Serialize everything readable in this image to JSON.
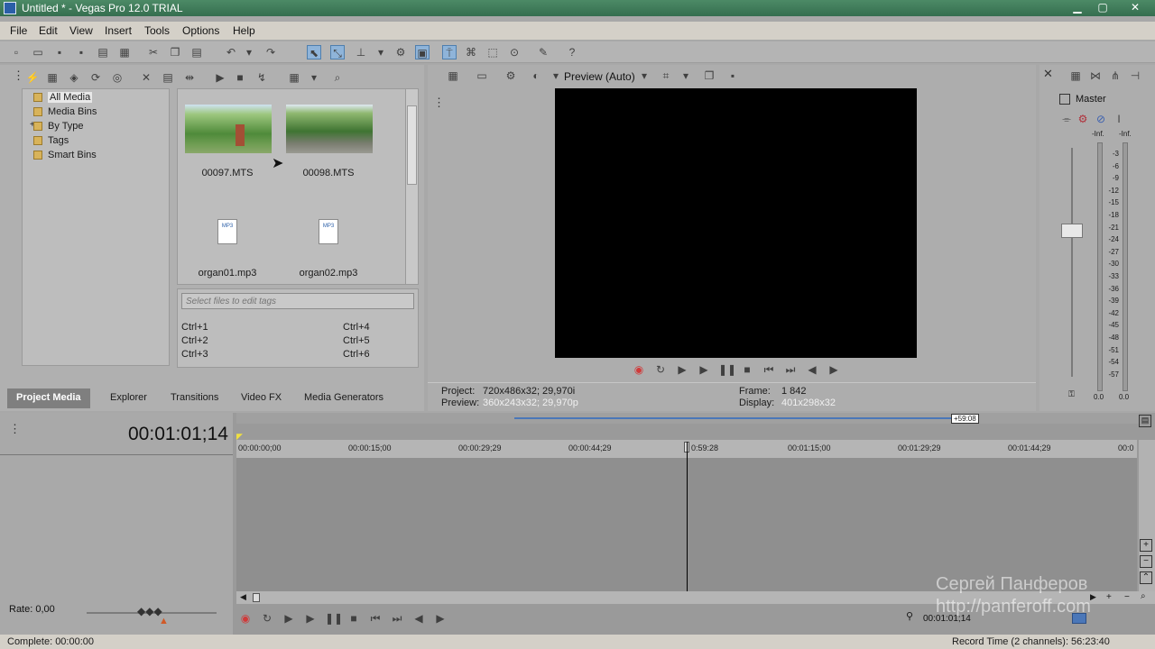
{
  "window": {
    "title": "Untitled * - Vegas Pro 12.0 TRIAL"
  },
  "menu": {
    "items": [
      "File",
      "Edit",
      "View",
      "Insert",
      "Tools",
      "Options",
      "Help"
    ]
  },
  "explorer": {
    "tree": [
      "All Media",
      "Media Bins",
      "By Type",
      "Tags",
      "Smart Bins"
    ],
    "expander": "+",
    "media": [
      {
        "name": "00097.MTS"
      },
      {
        "name": "00098.MTS"
      },
      {
        "name": "organ01.mp3",
        "badge": "MP3"
      },
      {
        "name": "organ02.mp3",
        "badge": "MP3"
      }
    ],
    "tag_placeholder": "Select files to edit tags",
    "shortcuts": [
      "Ctrl+1",
      "Ctrl+2",
      "Ctrl+3",
      "Ctrl+4",
      "Ctrl+5",
      "Ctrl+6"
    ]
  },
  "tabs": [
    "Project Media",
    "Explorer",
    "Transitions",
    "Video FX",
    "Media Generators"
  ],
  "preview": {
    "mode": "Preview (Auto)",
    "project_label": "Project:",
    "project_value": "720x486x32; 29,970i",
    "preview_label": "Preview:",
    "preview_value": "360x243x32; 29,970p",
    "frame_label": "Frame:",
    "frame_value": "1 842",
    "display_label": "Display:",
    "display_value": "401x298x32"
  },
  "master": {
    "label": "Master",
    "peak_left": "-Inf.",
    "peak_right": "-Inf.",
    "scale": [
      "3",
      "6",
      "9",
      "12",
      "15",
      "18",
      "21",
      "24",
      "27",
      "30",
      "33",
      "36",
      "39",
      "42",
      "45",
      "48",
      "51",
      "54",
      "57"
    ],
    "foot_left": "0.0",
    "foot_right": "0.0"
  },
  "timeline": {
    "timecode": "00:01:01;14",
    "ruler": [
      "00:00:00;00",
      "00:00:15;00",
      "00:00:29;29",
      "00:00:44;29",
      "0:59:28",
      "00:01:15;00",
      "00:01:29;29",
      "00:01:44;29",
      "00:0"
    ],
    "loop_length": "+59:08",
    "rate": "Rate: 0,00",
    "position": "00:01:01;14"
  },
  "status": {
    "complete": "Complete: 00:00:00",
    "record_time": "Record Time (2 channels): 56:23:40"
  },
  "watermark": {
    "name": "Сергей Панферов",
    "url": "http://panferoff.com"
  },
  "colors": {
    "title_bar": "#3f7e5a",
    "active_tab": "#7f7f7f",
    "record": "#d03a3a"
  }
}
